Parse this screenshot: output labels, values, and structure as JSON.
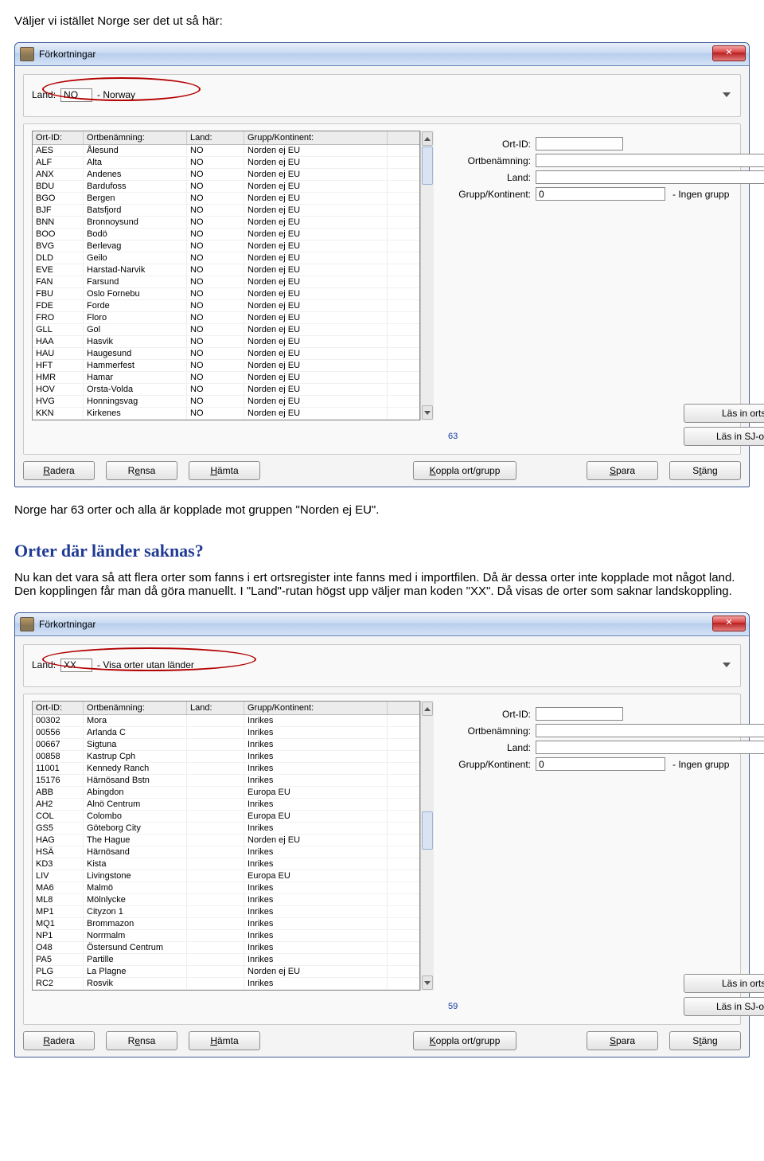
{
  "doc": {
    "intro": "Väljer vi istället Norge ser det ut så här:",
    "after1": "Norge har 63 orter och alla är kopplade mot gruppen \"Norden ej EU\".",
    "heading": "Orter där länder saknas?",
    "para2": "Nu kan det vara så att flera orter som fanns i ert ortsregister inte fanns med i importfilen. Då är dessa orter inte kopplade mot något land. Den kopplingen får man då göra manuellt. I \"Land\"-rutan högst upp väljer man koden \"XX\". Då visas de orter som saknar landskoppling."
  },
  "shared": {
    "window_title": "Förkortningar",
    "close_glyph": "✕",
    "land_label": "Land:",
    "columns": {
      "ort_id": "Ort-ID:",
      "ortbenamning": "Ortbenämning:",
      "land": "Land:",
      "grupp": "Grupp/Kontinent:"
    },
    "form": {
      "ort_id": "Ort-ID:",
      "ortbenamning": "Ortbenämning:",
      "land": "Land:",
      "grupp": "Grupp/Kontinent:",
      "grupp_code": "0",
      "grupp_text": "- Ingen grupp"
    },
    "buttons": {
      "las_in_ortsfil": "Läs in ortsfil",
      "las_in_sj": "Läs in SJ-orter",
      "radera": "Radera",
      "rensa": "Rensa",
      "hamta": "Hämta",
      "koppla": "Koppla ort/grupp",
      "spara": "Spara",
      "stang": "Stäng"
    },
    "hotkeys": {
      "radera": "R",
      "rensa": "e",
      "hamta": "H",
      "koppla": "K",
      "spara": "S",
      "stang": "t"
    }
  },
  "win1": {
    "land_code": "NO",
    "land_desc": "- Norway",
    "count": "63",
    "rows": [
      {
        "id": "AES",
        "name": "Ålesund",
        "land": "NO",
        "grp": "Norden ej EU"
      },
      {
        "id": "ALF",
        "name": "Alta",
        "land": "NO",
        "grp": "Norden ej EU"
      },
      {
        "id": "ANX",
        "name": "Andenes",
        "land": "NO",
        "grp": "Norden ej EU"
      },
      {
        "id": "BDU",
        "name": "Bardufoss",
        "land": "NO",
        "grp": "Norden ej EU"
      },
      {
        "id": "BGO",
        "name": "Bergen",
        "land": "NO",
        "grp": "Norden ej EU"
      },
      {
        "id": "BJF",
        "name": "Batsfjord",
        "land": "NO",
        "grp": "Norden ej EU"
      },
      {
        "id": "BNN",
        "name": "Bronnoysund",
        "land": "NO",
        "grp": "Norden ej EU"
      },
      {
        "id": "BOO",
        "name": "Bodö",
        "land": "NO",
        "grp": "Norden ej EU"
      },
      {
        "id": "BVG",
        "name": "Berlevag",
        "land": "NO",
        "grp": "Norden ej EU"
      },
      {
        "id": "DLD",
        "name": "Geilo",
        "land": "NO",
        "grp": "Norden ej EU"
      },
      {
        "id": "EVE",
        "name": "Harstad-Narvik",
        "land": "NO",
        "grp": "Norden ej EU"
      },
      {
        "id": "FAN",
        "name": "Farsund",
        "land": "NO",
        "grp": "Norden ej EU"
      },
      {
        "id": "FBU",
        "name": "Oslo Fornebu",
        "land": "NO",
        "grp": "Norden ej EU"
      },
      {
        "id": "FDE",
        "name": "Forde",
        "land": "NO",
        "grp": "Norden ej EU"
      },
      {
        "id": "FRO",
        "name": "Floro",
        "land": "NO",
        "grp": "Norden ej EU"
      },
      {
        "id": "GLL",
        "name": "Gol",
        "land": "NO",
        "grp": "Norden ej EU"
      },
      {
        "id": "HAA",
        "name": "Hasvik",
        "land": "NO",
        "grp": "Norden ej EU"
      },
      {
        "id": "HAU",
        "name": "Haugesund",
        "land": "NO",
        "grp": "Norden ej EU"
      },
      {
        "id": "HFT",
        "name": "Hammerfest",
        "land": "NO",
        "grp": "Norden ej EU"
      },
      {
        "id": "HMR",
        "name": "Hamar",
        "land": "NO",
        "grp": "Norden ej EU"
      },
      {
        "id": "HOV",
        "name": "Orsta-Volda",
        "land": "NO",
        "grp": "Norden ej EU"
      },
      {
        "id": "HVG",
        "name": "Honningsvag",
        "land": "NO",
        "grp": "Norden ej EU"
      },
      {
        "id": "KKN",
        "name": "Kirkenes",
        "land": "NO",
        "grp": "Norden ej EU"
      }
    ]
  },
  "win2": {
    "land_code": "XX",
    "land_desc": "- Visa orter utan länder",
    "count": "59",
    "rows": [
      {
        "id": "00302",
        "name": "Mora",
        "land": "",
        "grp": "Inrikes"
      },
      {
        "id": "00556",
        "name": "Arlanda C",
        "land": "",
        "grp": "Inrikes"
      },
      {
        "id": "00667",
        "name": "Sigtuna",
        "land": "",
        "grp": "Inrikes"
      },
      {
        "id": "00858",
        "name": "Kastrup Cph",
        "land": "",
        "grp": "Inrikes"
      },
      {
        "id": "11001",
        "name": "Kennedy Ranch",
        "land": "",
        "grp": "Inrikes"
      },
      {
        "id": "15176",
        "name": "Härnösand Bstn",
        "land": "",
        "grp": "Inrikes"
      },
      {
        "id": "ABB",
        "name": "Abingdon",
        "land": "",
        "grp": "Europa EU"
      },
      {
        "id": "AH2",
        "name": "Alnö Centrum",
        "land": "",
        "grp": "Inrikes"
      },
      {
        "id": "COL",
        "name": "Colombo",
        "land": "",
        "grp": "Europa EU"
      },
      {
        "id": "GS5",
        "name": "Göteborg City",
        "land": "",
        "grp": "Inrikes"
      },
      {
        "id": "HAG",
        "name": "The Hague",
        "land": "",
        "grp": "Norden ej EU"
      },
      {
        "id": "HSÄ",
        "name": "Härnösand",
        "land": "",
        "grp": "Inrikes"
      },
      {
        "id": "KD3",
        "name": "Kista",
        "land": "",
        "grp": "Inrikes"
      },
      {
        "id": "LIV",
        "name": "Livingstone",
        "land": "",
        "grp": "Europa EU"
      },
      {
        "id": "MA6",
        "name": "Malmö",
        "land": "",
        "grp": "Inrikes"
      },
      {
        "id": "ML8",
        "name": "Mölnlycke",
        "land": "",
        "grp": "Inrikes"
      },
      {
        "id": "MP1",
        "name": "Cityzon 1",
        "land": "",
        "grp": "Inrikes"
      },
      {
        "id": "MQ1",
        "name": "Brommazon",
        "land": "",
        "grp": "Inrikes"
      },
      {
        "id": "NP1",
        "name": "Norrmalm",
        "land": "",
        "grp": "Inrikes"
      },
      {
        "id": "O48",
        "name": "Östersund Centrum",
        "land": "",
        "grp": "Inrikes"
      },
      {
        "id": "PA5",
        "name": "Partille",
        "land": "",
        "grp": "Inrikes"
      },
      {
        "id": "PLG",
        "name": "La Plagne",
        "land": "",
        "grp": "Norden ej EU"
      },
      {
        "id": "RC2",
        "name": "Rosvik",
        "land": "",
        "grp": "Inrikes"
      }
    ]
  }
}
